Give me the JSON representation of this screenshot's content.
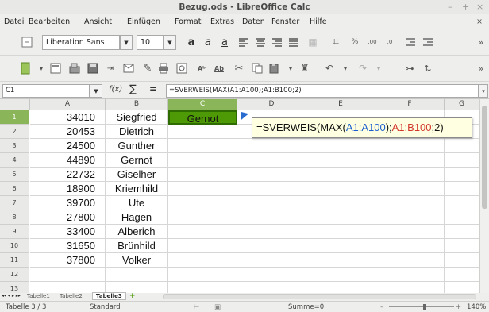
{
  "window": {
    "title": "Bezug.ods - LibreOffice Calc",
    "controls": [
      "–",
      "+",
      "×"
    ],
    "close": "×"
  },
  "menu": [
    "Datei",
    "Bearbeiten",
    "Ansicht",
    "Einfügen",
    "Format",
    "Extras",
    "Daten",
    "Fenster",
    "Hilfe"
  ],
  "toolbar": {
    "font_name": "Liberation Sans",
    "font_size": "10",
    "more": "»"
  },
  "formula_bar": {
    "name_box": "C1",
    "fx": "f(x)",
    "sum": "∑",
    "equals": "=",
    "formula": "=SVERWEIS(MAX(A1:A100);A1:B100;2)"
  },
  "columns": [
    "A",
    "B",
    "C",
    "D",
    "E",
    "F",
    "G"
  ],
  "rows": [
    {
      "n": "1",
      "a": "34010",
      "b": "Siegfried",
      "c": "Gernot"
    },
    {
      "n": "2",
      "a": "20453",
      "b": "Dietrich",
      "c": ""
    },
    {
      "n": "3",
      "a": "24500",
      "b": "Gunther",
      "c": ""
    },
    {
      "n": "4",
      "a": "44890",
      "b": "Gernot",
      "c": ""
    },
    {
      "n": "5",
      "a": "22732",
      "b": "Giselher",
      "c": ""
    },
    {
      "n": "6",
      "a": "18900",
      "b": "Kriemhild",
      "c": ""
    },
    {
      "n": "7",
      "a": "39700",
      "b": "Ute",
      "c": ""
    },
    {
      "n": "8",
      "a": "27800",
      "b": "Hagen",
      "c": ""
    },
    {
      "n": "9",
      "a": "33400",
      "b": "Alberich",
      "c": ""
    },
    {
      "n": "10",
      "a": "31650",
      "b": "Brünhild",
      "c": ""
    },
    {
      "n": "11",
      "a": "37800",
      "b": "Volker",
      "c": ""
    },
    {
      "n": "12",
      "a": "",
      "b": "",
      "c": ""
    },
    {
      "n": "13",
      "a": "",
      "b": "",
      "c": ""
    }
  ],
  "tooltip": {
    "prefix": "=SVERWEIS(MAX(",
    "ref1": "A1:A100",
    "mid": ");",
    "ref2": "A1:B100",
    "suffix": ";2)"
  },
  "sheets": [
    "Tabelle1",
    "Tabelle2",
    "Tabelle3"
  ],
  "status": {
    "sheet": "Tabelle 3 / 3",
    "style": "Standard",
    "sum": "Summe=0",
    "zoom": "140%"
  },
  "colors": {
    "active_cell": "#4e9a06",
    "ref1": "#1c5fcf",
    "ref2": "#d2392e",
    "tooltip_bg": "#ffffe1"
  }
}
